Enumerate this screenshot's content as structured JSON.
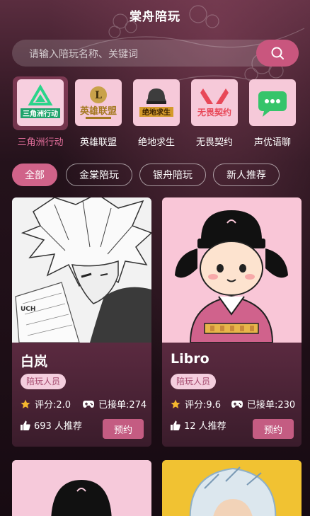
{
  "header": {
    "title": "棠舟陪玩"
  },
  "search": {
    "placeholder": "请输入陪玩名称、关键词",
    "icon": "search-icon"
  },
  "games": [
    {
      "label": "三角洲行动",
      "logo_text": "三角洲行动",
      "active": true
    },
    {
      "label": "英雄联盟",
      "logo_text": "英雄联盟",
      "active": false
    },
    {
      "label": "绝地求生",
      "logo_text": "绝地求生",
      "active": false
    },
    {
      "label": "无畏契约",
      "logo_text": "无畏契约",
      "active": false
    },
    {
      "label": "声优语聊",
      "logo_text": "",
      "active": false
    }
  ],
  "filters": [
    {
      "label": "全部",
      "active": true
    },
    {
      "label": "金棠陪玩",
      "active": false
    },
    {
      "label": "银舟陪玩",
      "active": false
    },
    {
      "label": "新人推荐",
      "active": false
    }
  ],
  "cards": [
    {
      "name": "白岚",
      "badge": "陪玩人员",
      "rating": "评分:2.0",
      "orders": "已接单:274",
      "recommend": "693 人推荐",
      "book": "预约"
    },
    {
      "name": "Libro",
      "badge": "陪玩人员",
      "rating": "评分:9.6",
      "orders": "已接单:230",
      "recommend": "12 人推荐",
      "book": "预约"
    }
  ],
  "colors": {
    "accent": "#d06389",
    "badge_bg": "#f4cede",
    "star": "#f5b82e"
  }
}
